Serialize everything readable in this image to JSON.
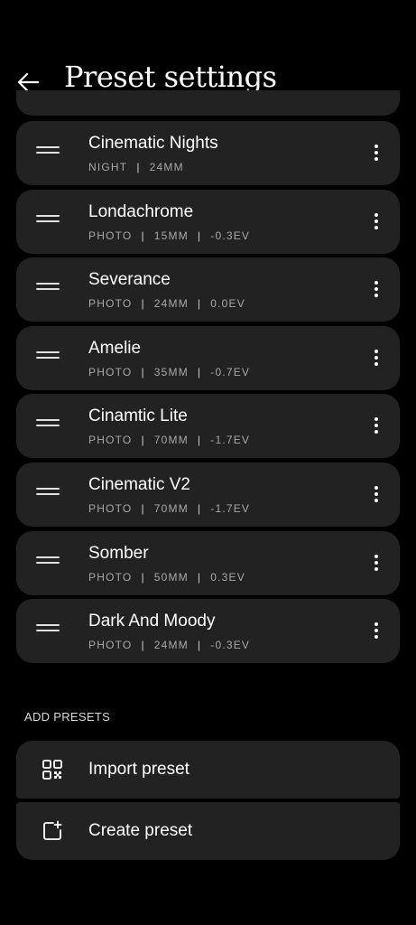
{
  "header": {
    "title": "Preset settings",
    "back_icon": "arrow-left-icon"
  },
  "presets": [
    {
      "name": "Cinematic Nights",
      "meta": [
        "NIGHT",
        "24MM"
      ]
    },
    {
      "name": "Londachrome",
      "meta": [
        "PHOTO",
        "15MM",
        "-0.3EV"
      ]
    },
    {
      "name": "Severance",
      "meta": [
        "PHOTO",
        "24MM",
        "0.0EV"
      ]
    },
    {
      "name": "Amelie",
      "meta": [
        "PHOTO",
        "35MM",
        "-0.7EV"
      ]
    },
    {
      "name": "Cinamtic Lite",
      "meta": [
        "PHOTO",
        "70MM",
        "-1.7EV"
      ]
    },
    {
      "name": "Cinematic V2",
      "meta": [
        "PHOTO",
        "70MM",
        "-1.7EV"
      ]
    },
    {
      "name": "Somber",
      "meta": [
        "PHOTO",
        "50MM",
        "0.3EV"
      ]
    },
    {
      "name": "Dark And Moody",
      "meta": [
        "PHOTO",
        "24MM",
        "-0.3EV"
      ]
    }
  ],
  "meta_separator": "|",
  "add_presets": {
    "section_label": "ADD PRESETS",
    "import_label": "Import preset",
    "import_icon": "qr-code-icon",
    "create_label": "Create preset",
    "create_icon": "add-frame-icon"
  },
  "colors": {
    "background": "#000000",
    "card": "#222222",
    "text_primary": "#ffffff",
    "text_secondary": "#a8a8a8"
  }
}
